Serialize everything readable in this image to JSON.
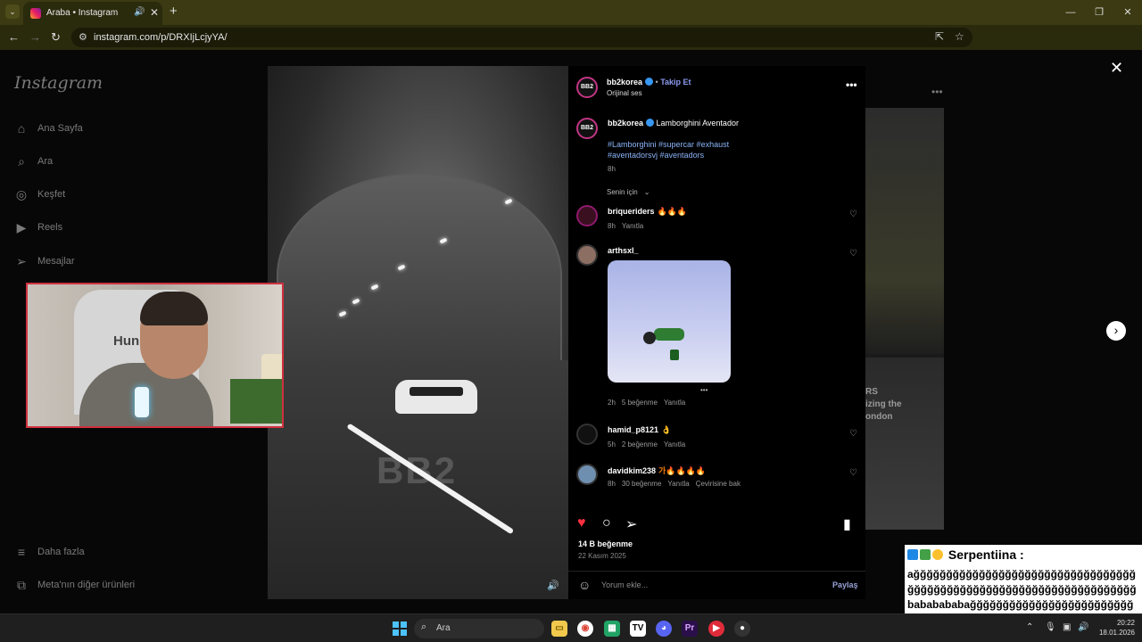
{
  "browser": {
    "tab_title": "Araba • Instagram",
    "url": "instagram.com/p/DRXIjLcjyYA/"
  },
  "sidebar": {
    "logo": "Instagram",
    "items": [
      {
        "label": "Ana Sayfa",
        "icon": "home-icon"
      },
      {
        "label": "Ara",
        "icon": "search-icon"
      },
      {
        "label": "Keşfet",
        "icon": "explore-icon"
      },
      {
        "label": "Reels",
        "icon": "reels-icon"
      },
      {
        "label": "Mesajlar",
        "icon": "messages-icon"
      }
    ],
    "more": "Daha fazla",
    "meta": "Meta'nın diğer ürünleri"
  },
  "post": {
    "author": "bb2korea",
    "avatar_text": "BB2",
    "follow": "Takip Et",
    "sound": "Orijinal ses",
    "caption": "Lamborghini Aventador",
    "hashtags": "#Lamborghini #supercar #exhaust #aventadorsvj #aventadors",
    "caption_time": "8h",
    "sort": "Senin için",
    "likes": "14 B beğenme",
    "date": "22 Kasım 2025",
    "comment_placeholder": "Yorum ekle...",
    "share": "Paylaş",
    "video_watermark": "BB2"
  },
  "comments": [
    {
      "user": "briqueriders",
      "text": "🔥🔥🔥",
      "time": "8h",
      "likes": "",
      "reply": "Yanıtla",
      "translate": ""
    },
    {
      "user": "arthsxl_",
      "text": "",
      "time": "2h",
      "likes": "5 beğenme",
      "reply": "Yanıtla",
      "translate": ""
    },
    {
      "user": "hamid_p8121",
      "text": "👌",
      "time": "5h",
      "likes": "2 beğenme",
      "reply": "Yanıtla",
      "translate": ""
    },
    {
      "user": "davidkim238",
      "text": "가🔥🔥🔥🔥",
      "time": "8h",
      "likes": "30 beğenme",
      "reply": "Yanıtla",
      "translate": "Çevirisine bak"
    }
  ],
  "background_grid": {
    "caption": "RS\nizing the\nondon"
  },
  "chat": {
    "author": "Serpentiina :",
    "message": "ağğğğğğğğğğğğğğğğğğğğğğğğğğğğğğğğğğğğğğğğğğğğğğğğğğğğğğğğğğğğğğğğğğğğğbababababağğğğğğğğğğğğğğğğğğğğğğğğğğğğğ"
  },
  "taskbar": {
    "search_placeholder": "Ara",
    "time": "20:22",
    "date": "18.01.2026"
  },
  "colors": {
    "chrome_bg": "#3b3a12",
    "instagram_bg": "#070707",
    "like_red": "#ff3040",
    "link_blue": "#8ab4f8",
    "webcam_border": "#d0303f"
  }
}
